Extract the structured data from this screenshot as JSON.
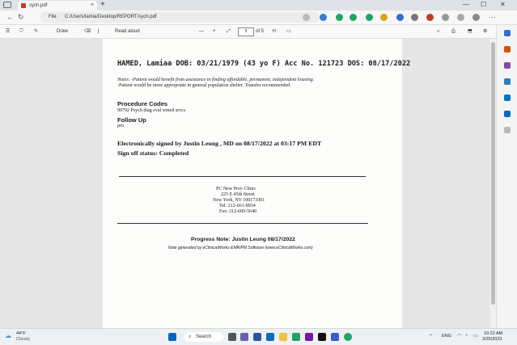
{
  "browser": {
    "tab_title": "sych.pdf",
    "tab_close": "×",
    "new_tab": "+",
    "address_scheme": "File",
    "address_url": "C:/Users/lamia/Desktop/REPORT/sych.pdf",
    "window_minimize": "—",
    "window_maximize": "☐",
    "window_close": "✕"
  },
  "pdf_toolbar": {
    "draw_label": "Draw",
    "read_aloud_label": "Read aloud",
    "zoom_out": "—",
    "zoom_in": "+",
    "page_number": "5",
    "page_total": "of 5"
  },
  "document": {
    "header_line": "HAMED, Lamiaa DOB: 03/21/1979 (43 yo F) Acc No. 121723 DOS: 08/17/2022",
    "notes_line1": "Notes: -Patient would benefit from assistance in finding affordable, permanent, independent housing.",
    "notes_line2": "-Patient would be more appropriate in general population shelter. Transfer recommended.",
    "procedure_heading": "Procedure Codes",
    "procedure_code": "90792 Psych diag eval wmed srvcs",
    "followup_heading": "Follow Up",
    "followup_value": "prn",
    "signed_line": "Electronically signed by Justin Leung , MD on 08/17/2022 at 03:17 PM EDT",
    "signoff_line": "Sign off status: Completed",
    "clinic_name": "PC New Prov Clinic",
    "clinic_street": "225 E 45th Street",
    "clinic_city": "New York, NY 100173301",
    "clinic_tel": "Tel: 212-661-8934",
    "clinic_fax": "Fax: 212-600-5640",
    "progress_note": "Progress Note: Justin Leung    08/17/2022",
    "generated_by": "Note generated by eClinicalWorks EMR/PM Software (www.eClinicalWorks.com)"
  },
  "taskbar": {
    "weather_temp": "44°F",
    "weather_desc": "Cloudy",
    "search_label": "Search",
    "language": "ENG",
    "time": "10:22 AM",
    "date": "3/25/2023"
  },
  "colors": {
    "pdf_icon": "#d93025",
    "windows_blue": "#0067c0",
    "edge_green": "#1fa463"
  }
}
